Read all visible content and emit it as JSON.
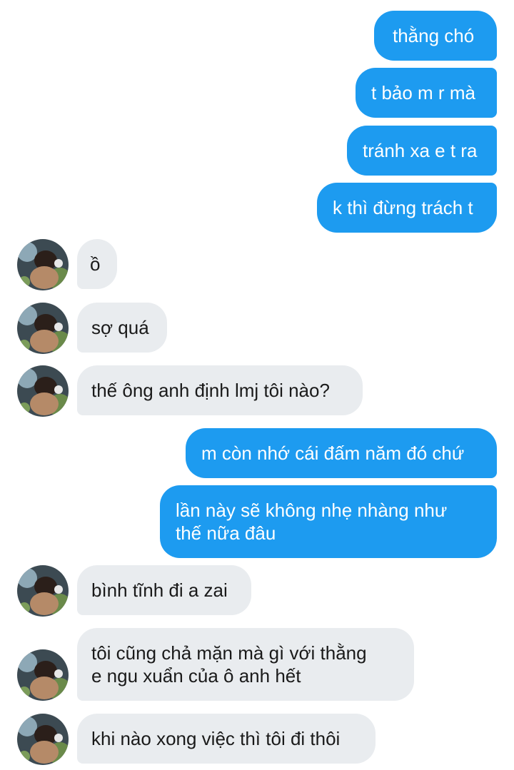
{
  "colors": {
    "outgoing_bubble": "#1d9bf0",
    "incoming_bubble": "#e9ecef",
    "outgoing_text": "#ffffff",
    "incoming_text": "#1a1a1a"
  },
  "messages": [
    {
      "sender": "me",
      "lines": [
        "thằng chó"
      ]
    },
    {
      "sender": "me",
      "lines": [
        "t bảo m r mà"
      ]
    },
    {
      "sender": "me",
      "lines": [
        "tránh xa e t ra"
      ]
    },
    {
      "sender": "me",
      "lines": [
        "k thì đừng trách t"
      ]
    },
    {
      "sender": "them",
      "lines": [
        "ồ"
      ]
    },
    {
      "sender": "them",
      "lines": [
        "sợ quá"
      ]
    },
    {
      "sender": "them",
      "lines": [
        "thế ông anh định lmj tôi nào?"
      ]
    },
    {
      "sender": "me",
      "lines": [
        "m còn nhớ cái đấm năm đó chứ"
      ]
    },
    {
      "sender": "me",
      "lines": [
        "lần này sẽ không nhẹ nhàng như",
        "thế nữa đâu"
      ]
    },
    {
      "sender": "them",
      "lines": [
        "bình tĩnh đi a zai"
      ]
    },
    {
      "sender": "them",
      "lines": [
        "tôi cũng chả mặn mà gì với thằng",
        "e ngu xuẩn của ô anh hết"
      ]
    },
    {
      "sender": "them",
      "lines": [
        "khi nào xong việc thì tôi đi thôi"
      ]
    }
  ]
}
